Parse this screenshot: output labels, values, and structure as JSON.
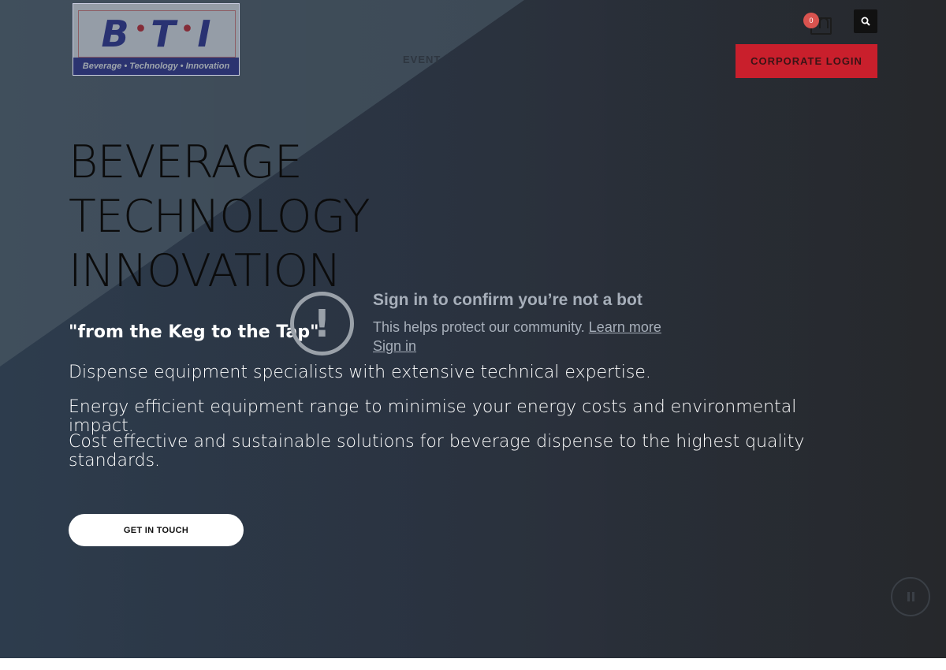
{
  "logo": {
    "letters": [
      "B",
      "T",
      "I"
    ],
    "tagline": "Beverage • Technology • Innovation"
  },
  "nav": {
    "items": [
      "EVENT",
      "",
      "",
      ""
    ],
    "corporate_login": "CORPORATE LOGIN"
  },
  "cart": {
    "count": "0",
    "icon": "shopping-bag-icon"
  },
  "search": {
    "icon": "search-icon"
  },
  "hero": {
    "title_lines": [
      "BEVERAGE",
      "TECHNOLOGY",
      "INNOVATION"
    ],
    "tagline": "\"from the Keg to the Tap\"",
    "paragraphs": [
      "Dispense equipment specialists with extensive technical expertise.",
      "Energy efficient equipment range to minimise your energy costs and environmental impact.",
      "Cost effective and sustainable solutions for beverage dispense to the highest quality standards."
    ],
    "cta": "GET IN TOUCH"
  },
  "bot_check": {
    "title": "Sign in to confirm you’re not a bot",
    "text": "This helps protect our community.",
    "learn_more": "Learn more",
    "sign_in": "Sign in",
    "icon": "exclamation-icon"
  },
  "colors": {
    "accent_red": "#c91f2c",
    "logo_blue": "#2e3192",
    "hero_dark": "#2c3543"
  }
}
